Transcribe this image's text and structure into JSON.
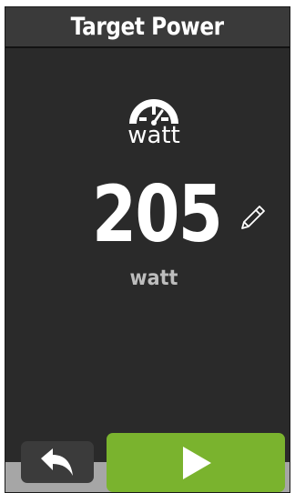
{
  "header": {
    "title": "Target Power"
  },
  "metric": {
    "icon": "power-meter-icon",
    "icon_label": "watt",
    "value": "205",
    "unit": "watt",
    "edit_icon": "pencil-icon"
  },
  "footer": {
    "back_icon": "back-arrow-icon",
    "start_icon": "play-icon"
  },
  "colors": {
    "background": "#2a2a2a",
    "title_bar": "#3a3a3a",
    "start_button": "#7ab32e",
    "back_button": "#3b3b3b",
    "bottom_strip": "#a6a6a6",
    "unit_text": "#bdbdbd"
  }
}
